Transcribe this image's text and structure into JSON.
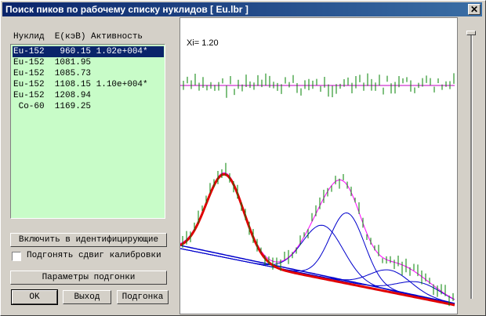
{
  "window": {
    "title": "Поиск пиков по рабочему списку нуклидов [ Eu.lbr ]",
    "close": "✕"
  },
  "list": {
    "header": "Нуклид  E(кэВ) Активность",
    "rows": [
      "Eu-152   960.15 1.02e+004*",
      "Eu-152  1081.95",
      "Eu-152  1085.73",
      "Eu-152  1108.15 1.10e+004*",
      "Eu-152  1208.94",
      " Co-60  1169.25"
    ]
  },
  "buttons": {
    "include": "Включить в идентифицирующие",
    "params": "Параметры подгонки",
    "ok": "OK",
    "exit": "Выход",
    "fit": "Подгонка"
  },
  "checkbox": {
    "label": "Подгонять сдвиг калибровки",
    "checked": false
  },
  "plot": {
    "xi_label": "Xi= 1.20",
    "colors": {
      "total_fit": "#ff00ff",
      "highlight_peak": "#e00000",
      "components": "#0000cc",
      "data": "#008000",
      "residual_line": "#c000c0"
    }
  }
}
